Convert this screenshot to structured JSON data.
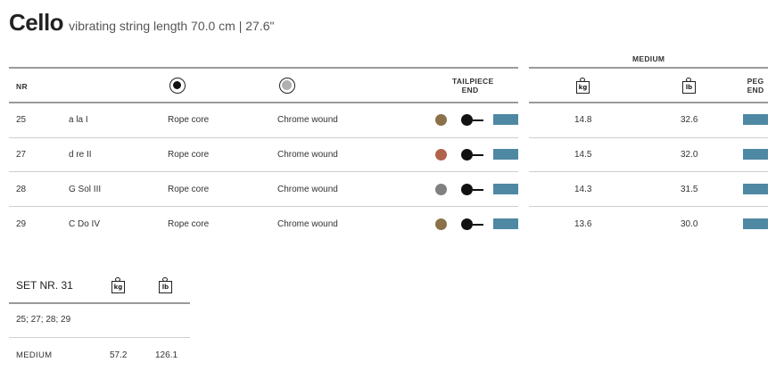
{
  "header": {
    "instrument": "Cello",
    "subtitle": "vibrating string length 70.0 cm | 27.6\""
  },
  "table": {
    "col_nr": "NR",
    "col_tailpiece_line1": "TAILPIECE",
    "col_tailpiece_line2": "END",
    "tension_group": "MEDIUM",
    "col_kg": "kg",
    "col_lb": "lb",
    "col_peg_line1": "PEG",
    "col_peg_line2": "END",
    "rows": [
      {
        "nr": "25",
        "note": "a  la  I",
        "core": "Rope core",
        "winding": "Chrome wound",
        "color": "#8a7148",
        "kg": "14.8",
        "lb": "32.6"
      },
      {
        "nr": "27",
        "note": "d  re  II",
        "core": "Rope core",
        "winding": "Chrome wound",
        "color": "#b0624a",
        "kg": "14.5",
        "lb": "32.0"
      },
      {
        "nr": "28",
        "note": "G  Sol  III",
        "core": "Rope core",
        "winding": "Chrome wound",
        "color": "#808080",
        "kg": "14.3",
        "lb": "31.5"
      },
      {
        "nr": "29",
        "note": "C  Do  IV",
        "core": "Rope core",
        "winding": "Chrome wound",
        "color": "#8a7148",
        "kg": "13.6",
        "lb": "30.0"
      }
    ]
  },
  "set": {
    "title": "SET NR. 31",
    "kg": "kg",
    "lb": "lb",
    "strings": "25; 27; 28; 29",
    "tension_label": "MEDIUM",
    "total_kg": "57.2",
    "total_lb": "126.1"
  },
  "colors": {
    "bar": "#4e88a3"
  }
}
